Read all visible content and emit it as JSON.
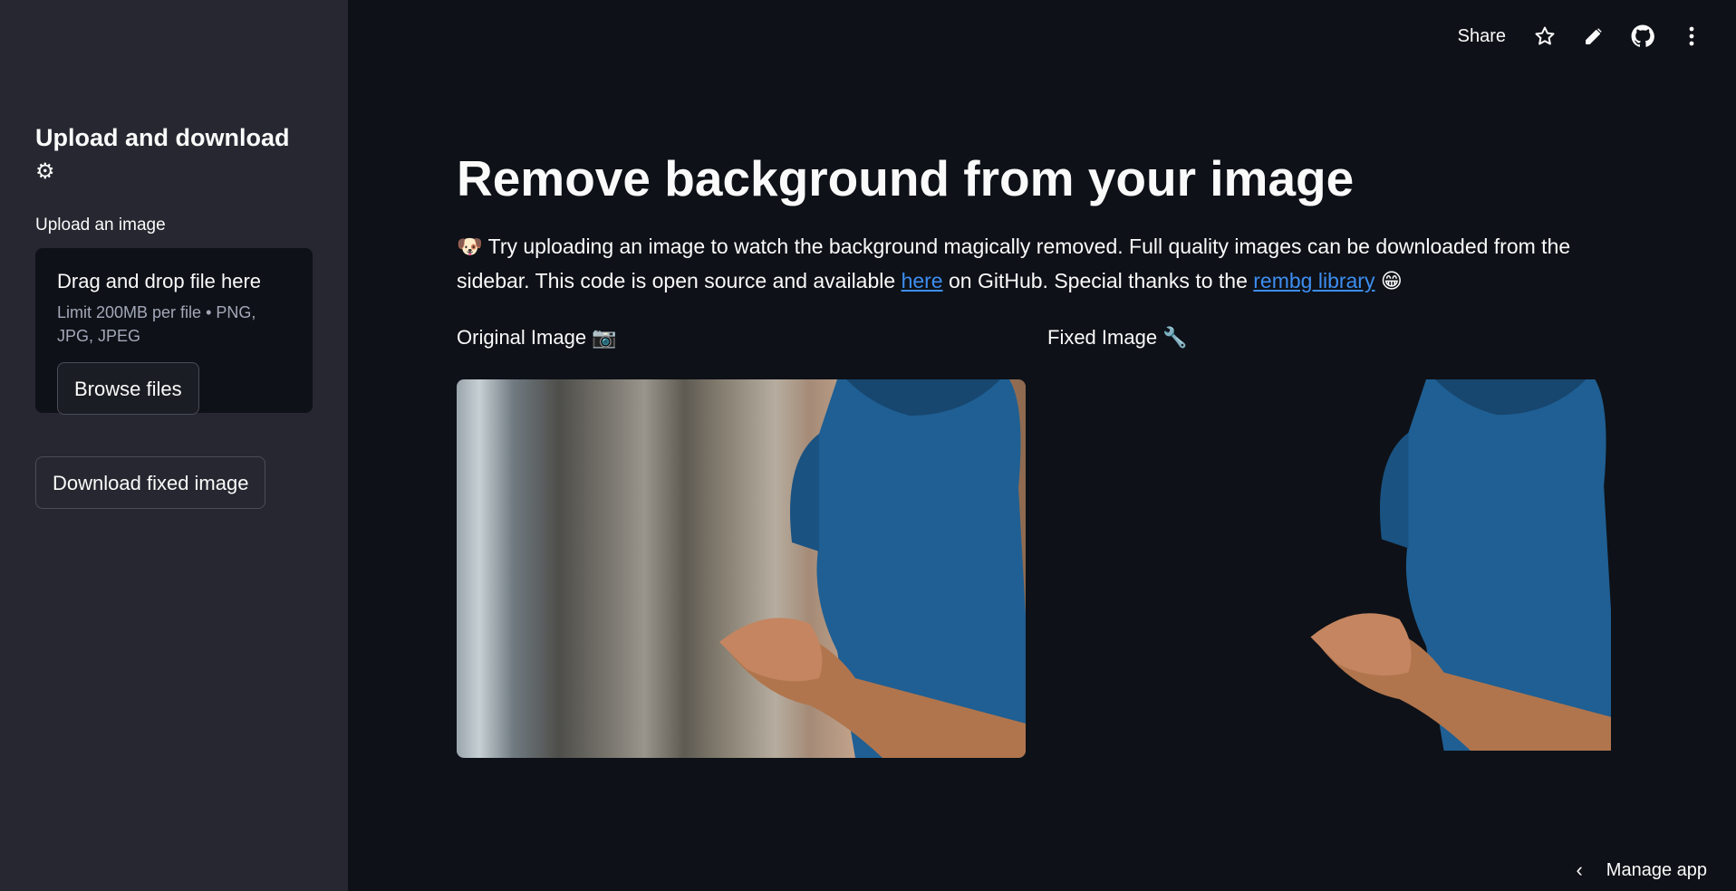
{
  "sidebar": {
    "title": "Upload and download",
    "title_icon": "⚙",
    "upload_label": "Upload an image",
    "dropzone_title": "Drag and drop file here",
    "dropzone_limit": "Limit 200MB per file • PNG, JPG, JPEG",
    "browse_label": "Browse files",
    "download_label": "Download fixed image"
  },
  "header": {
    "share_label": "Share",
    "icons": [
      "star-icon",
      "pencil-icon",
      "github-icon",
      "more-vertical-icon"
    ]
  },
  "main": {
    "title": "Remove background from your image",
    "intro_emoji": "🐶",
    "intro_text_1": "Try uploading an image to watch the background magically removed. Full quality images can be downloaded from the sidebar. This code is open source and available",
    "intro_link_here": "here",
    "intro_text_2": "on GitHub. Special thanks to the",
    "intro_link_rembg": "rembg library",
    "intro_emoji_end": "😁",
    "original_label": "Original Image 📷",
    "fixed_label": "Fixed Image 🔧"
  },
  "footer": {
    "manage_label": "Manage app"
  },
  "colors": {
    "background": "#0e1117",
    "sidebar": "#262730",
    "link": "#3d8ef2",
    "shirt": "#1f5f93"
  }
}
